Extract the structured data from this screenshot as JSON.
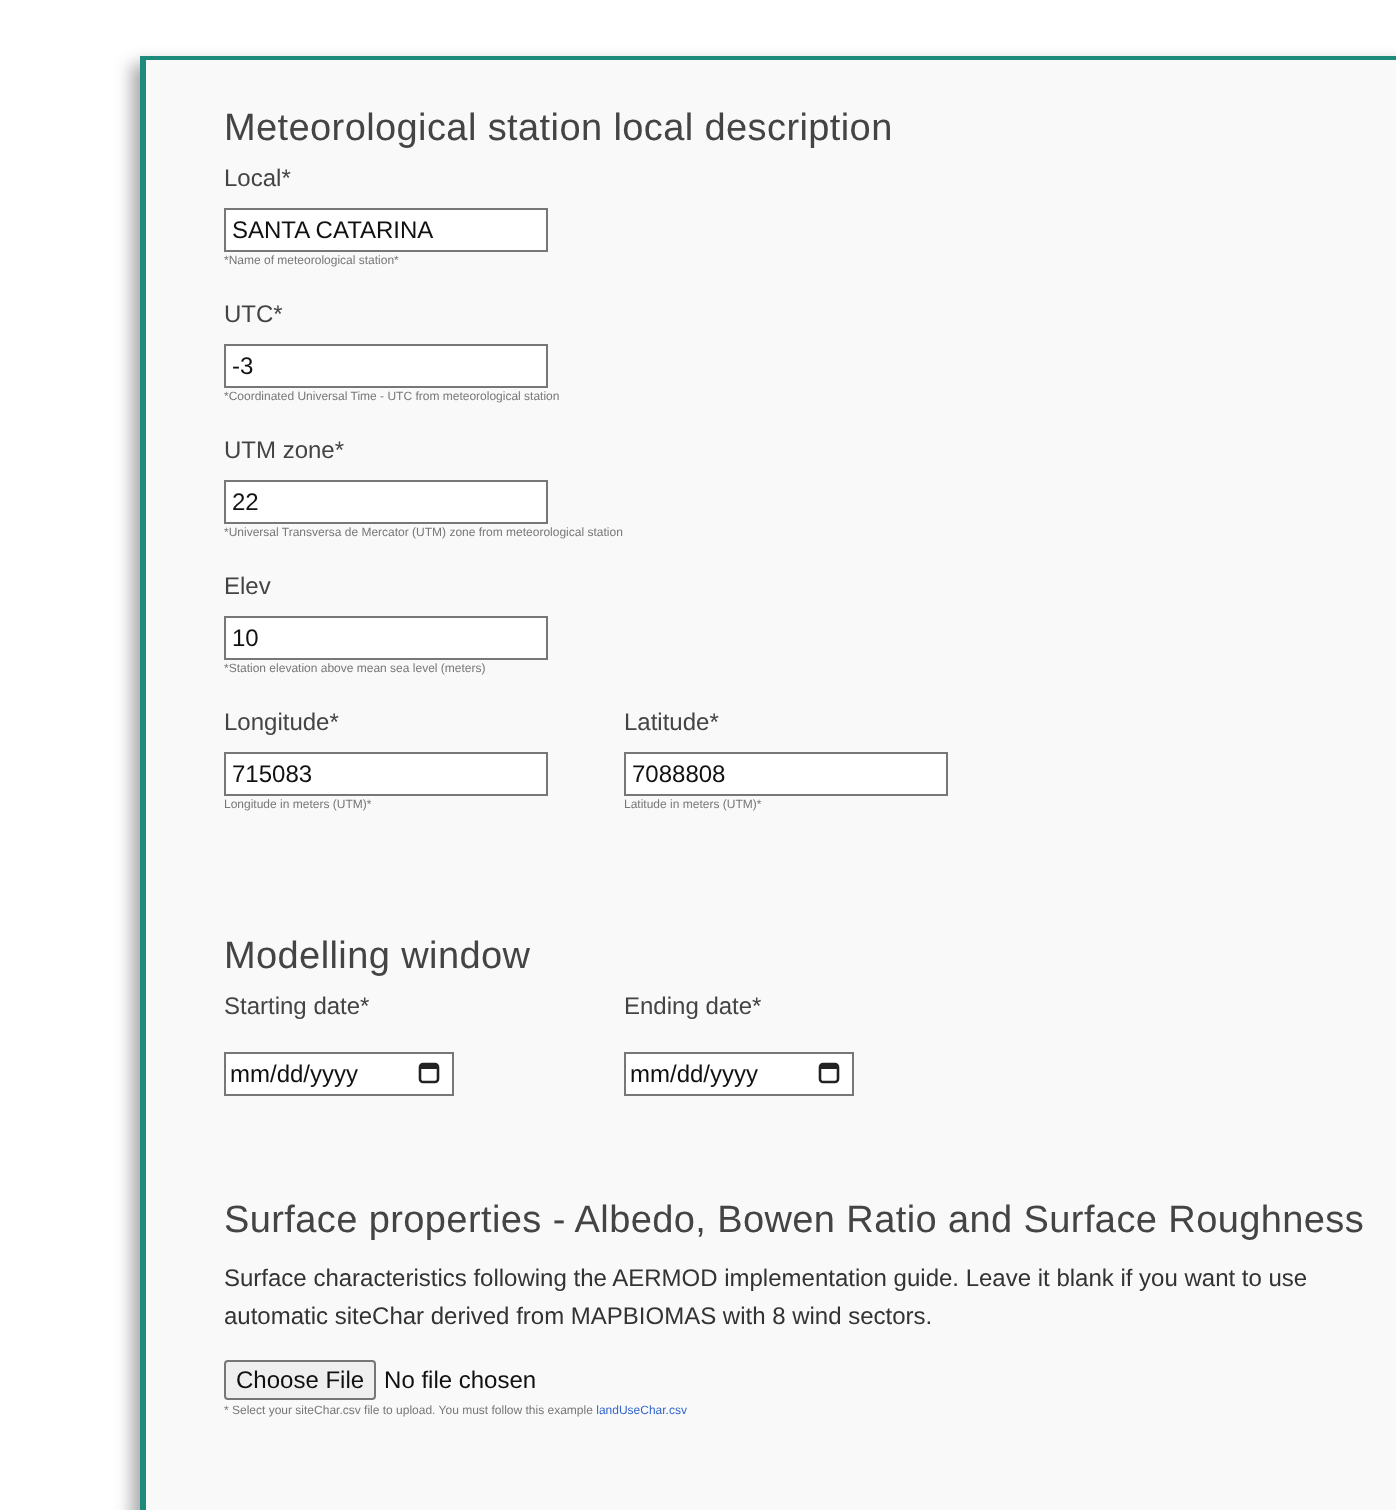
{
  "sections": [
    {
      "title": "Meteorological station local description",
      "rows": [
        [
          {
            "label": "Local*",
            "value": "SANTA CATARINA",
            "hint": "*Name of meteorological station*"
          }
        ],
        [
          {
            "label": "UTC*",
            "value": "-3",
            "hint": "*Coordinated Universal Time - UTC from meteorological station"
          }
        ],
        [
          {
            "label": "UTM zone*",
            "value": "22",
            "hint": "*Universal Transversa de Mercator (UTM) zone from meteorological station"
          }
        ],
        [
          {
            "label": "Elev",
            "value": "10",
            "hint": "*Station elevation above mean sea level (meters)"
          }
        ],
        [
          {
            "label": "Longitude*",
            "value": "715083",
            "hint": "Longitude in meters (UTM)*"
          },
          {
            "label": "Latitude*",
            "value": "7088808",
            "hint": "Latitude in meters (UTM)*"
          }
        ]
      ]
    },
    {
      "title": "Modelling window",
      "dates": [
        {
          "label": "Starting date*",
          "placeholder": "mm/dd/yyyy"
        },
        {
          "label": "Ending date*",
          "placeholder": "mm/dd/yyyy"
        }
      ]
    },
    {
      "title": "Surface properties - Albedo, Bowen Ratio and Surface Roughness",
      "text": "Surface characteristics following the AERMOD implementation guide. Leave it blank if you want to use automatic siteChar derived from MAPBIOMAS with 8 wind sectors.",
      "file": {
        "button": "Choose File",
        "status": "No file chosen",
        "note": "* Select your siteChar.csv file to upload. You must follow this example",
        "link": "landUseChar.csv"
      }
    }
  ]
}
